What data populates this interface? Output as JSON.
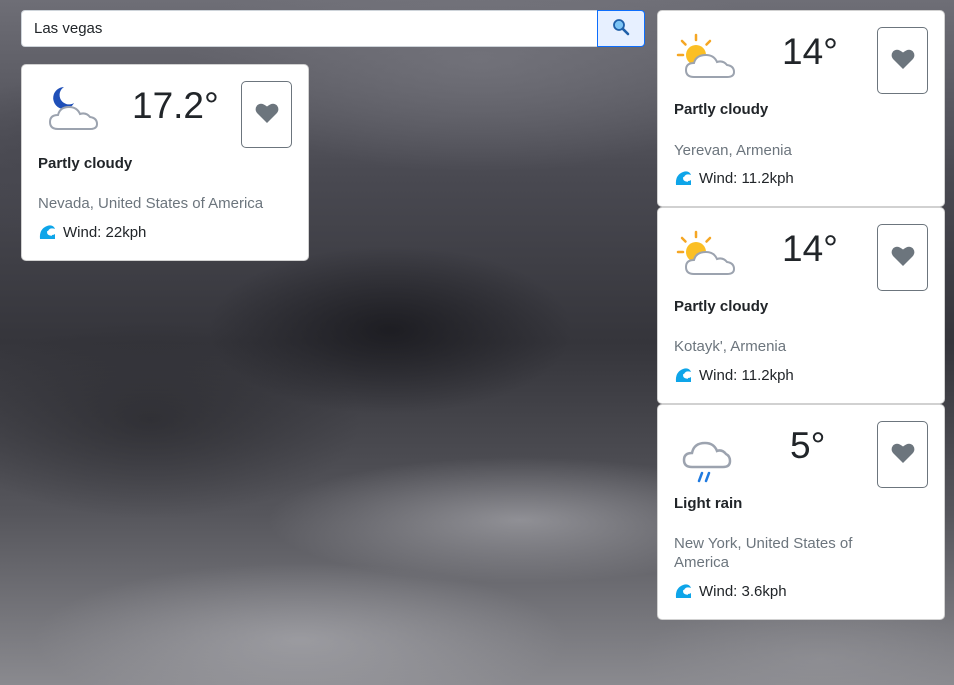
{
  "search": {
    "value": "Las vegas",
    "placeholder": "",
    "button_icon": "magnifier-icon"
  },
  "results": {
    "temp": "17.2°",
    "condition": "Partly cloudy",
    "condition_icon": "moon-cloud-icon",
    "location": "Nevada, United States of America",
    "wind": "Wind: 22kph",
    "favorite_icon": "heart-icon"
  },
  "favorites": [
    {
      "temp": "14°",
      "condition": "Partly cloudy",
      "condition_icon": "sun-cloud-icon",
      "location": "Yerevan, Armenia",
      "wind": "Wind: 11.2kph"
    },
    {
      "temp": "14°",
      "condition": "Partly cloudy",
      "condition_icon": "sun-cloud-icon",
      "location": "Kotayk', Armenia",
      "wind": "Wind: 11.2kph"
    },
    {
      "temp": "5°",
      "condition": "Light rain",
      "condition_icon": "rain-cloud-icon",
      "location": "New York, United States of America",
      "wind": "Wind: 3.6kph"
    }
  ],
  "colors": {
    "card_bg": "#ffffff",
    "heart": "#6c757d",
    "wind_wave": "#0ea5e9",
    "search_accent": "#0d6efd"
  }
}
